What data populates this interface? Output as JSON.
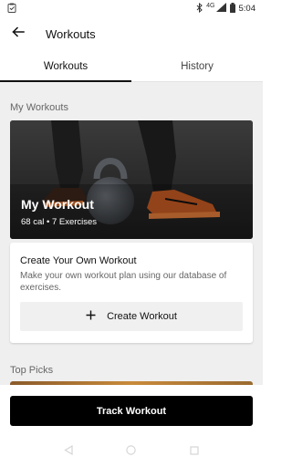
{
  "status_bar": {
    "time": "5:04",
    "network": "4G",
    "icons": [
      "clipboard-check-icon",
      "bluetooth-icon",
      "signal-icon",
      "battery-icon"
    ]
  },
  "app_bar": {
    "title": "Workouts",
    "back_icon": "arrow-left-icon"
  },
  "tabs": [
    {
      "label": "Workouts",
      "active": true
    },
    {
      "label": "History",
      "active": false
    }
  ],
  "my_workouts": {
    "section_title": "My Workouts",
    "card": {
      "title": "My Workout",
      "subtitle": "68 cal • 7 Exercises"
    }
  },
  "create_workout": {
    "title": "Create Your Own Workout",
    "description": "Make your own workout plan using our database of exercises.",
    "button_label": "Create Workout",
    "button_icon": "plus-icon"
  },
  "top_picks": {
    "section_title": "Top Picks"
  },
  "track_button": {
    "label": "Track Workout"
  },
  "nav_bar": {
    "icons": [
      "back-triangle-icon",
      "home-circle-icon",
      "recents-square-icon"
    ]
  },
  "colors": {
    "primary": "#000000",
    "background": "#efefef",
    "card": "#ffffff"
  }
}
